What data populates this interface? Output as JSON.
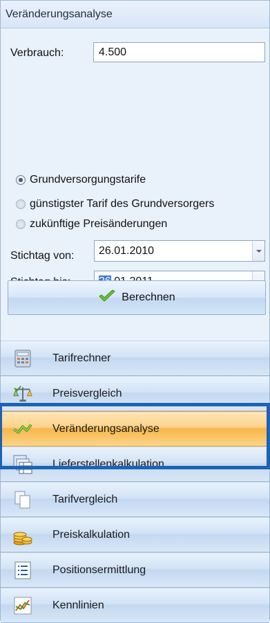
{
  "panel": {
    "title": "Veränderungsanalyse",
    "verbrauch_label": "Verbrauch:",
    "verbrauch_value": "4.500",
    "radios": [
      {
        "label": "Grundversorgungstarife",
        "checked": true
      },
      {
        "label": "günstigster Tarif des Grundversorgers",
        "checked": false
      },
      {
        "label": "zukünftige Preisänderungen",
        "checked": false
      }
    ],
    "stichtag_von_label": "Stichtag von:",
    "stichtag_von_value": "26.01.2010",
    "stichtag_bis_label": "Stichtag bis:",
    "stichtag_bis_selected": "26",
    "stichtag_bis_rest": ".01.2011",
    "calc_button": "Berechnen"
  },
  "nav": {
    "items": [
      {
        "label": "Tarifrechner",
        "icon": "calculator-icon",
        "active": false
      },
      {
        "label": "Preisvergleich",
        "icon": "scales-icon",
        "active": false
      },
      {
        "label": "Veränderungsanalyse",
        "icon": "trend-chart-icon",
        "active": true
      },
      {
        "label": "Lieferstellenkalkulation",
        "icon": "table-stack-icon",
        "active": false
      },
      {
        "label": "Tarifvergleich",
        "icon": "documents-icon",
        "active": false
      },
      {
        "label": "Preiskalkulation",
        "icon": "coins-icon",
        "active": false
      },
      {
        "label": "Positionsermittlung",
        "icon": "list-icon",
        "active": false
      },
      {
        "label": "Kennlinien",
        "icon": "line-chart-icon",
        "active": false
      }
    ]
  },
  "colors": {
    "highlight_border": "#1c63b2",
    "active_item": "#f8b74a",
    "panel_bg": "#e9f1fb"
  }
}
